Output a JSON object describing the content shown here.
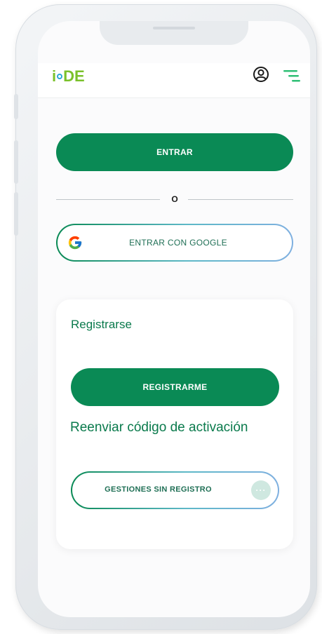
{
  "header": {
    "logo_i": "i",
    "logo_de": "DE",
    "user_icon": "user-circle-icon",
    "menu_icon": "hamburger-menu-icon"
  },
  "login": {
    "enter_label": "ENTRAR",
    "or_label": "O",
    "google_label": "ENTRAR CON GOOGLE",
    "google_icon": "google-g-icon"
  },
  "register_card": {
    "title": "Registrarse",
    "register_button": "REGISTRARME",
    "resend_link": "Reenviar código de activación",
    "no_register_button": "GESTIONES SIN REGISTRO",
    "more_icon": "more-dots-icon"
  },
  "colors": {
    "primary_green": "#0a8a55",
    "text_green": "#0a7a4c",
    "logo_green": "#7ac12a",
    "logo_blue": "#2aa8d8"
  }
}
